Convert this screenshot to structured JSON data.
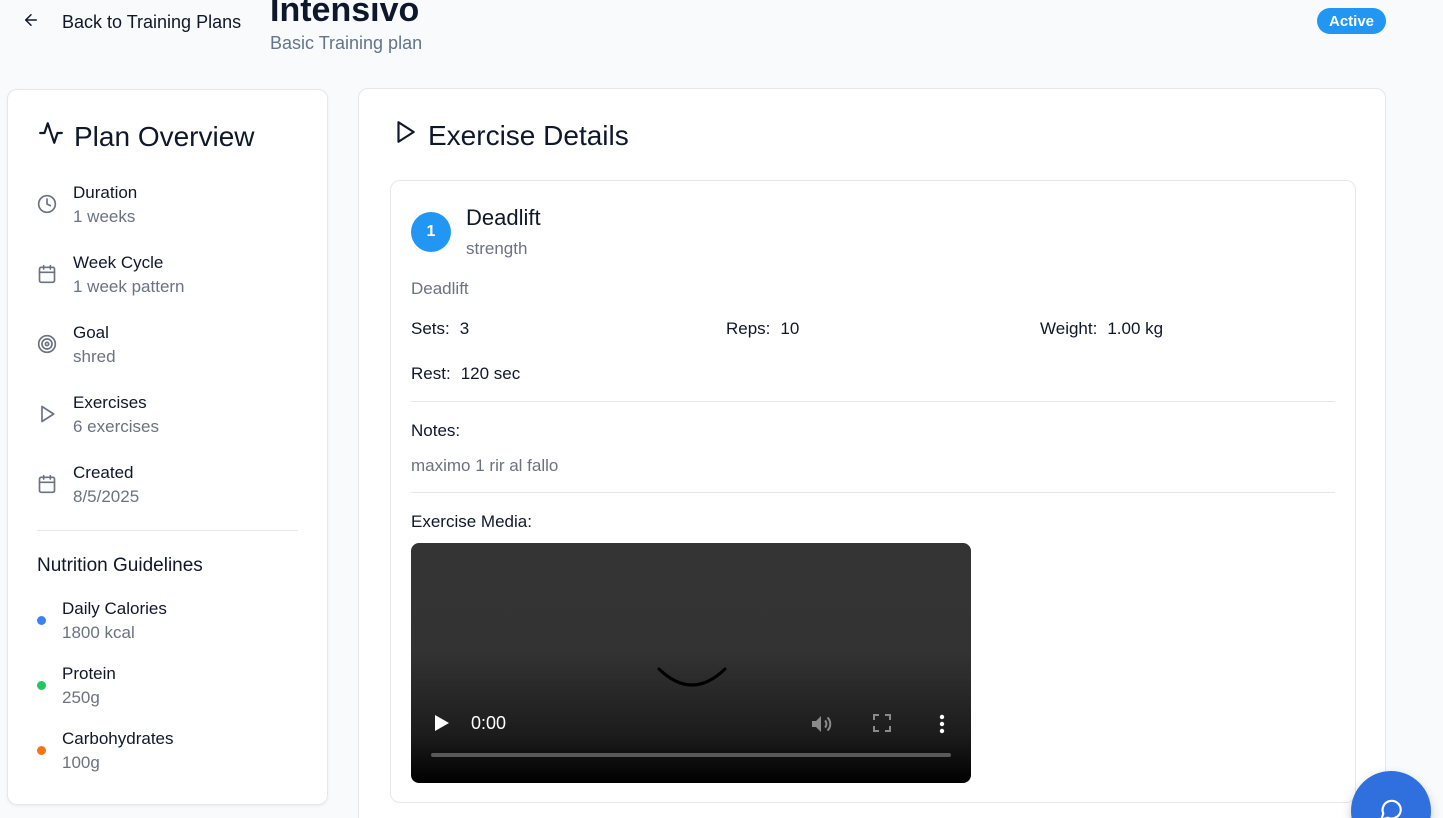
{
  "header": {
    "back_label": "Back to Training Plans",
    "title": "Intensivo",
    "subtitle": "Basic Training plan",
    "status": "Active"
  },
  "overview": {
    "title": "Plan Overview",
    "items": [
      {
        "label": "Duration",
        "value": "1 weeks",
        "icon": "clock-icon"
      },
      {
        "label": "Week Cycle",
        "value": "1 week pattern",
        "icon": "calendar-icon"
      },
      {
        "label": "Goal",
        "value": "shred",
        "icon": "target-icon"
      },
      {
        "label": "Exercises",
        "value": "6 exercises",
        "icon": "play-icon"
      },
      {
        "label": "Created",
        "value": "8/5/2025",
        "icon": "calendar-icon"
      }
    ]
  },
  "nutrition": {
    "title": "Nutrition Guidelines",
    "items": [
      {
        "label": "Daily Calories",
        "value": "1800 kcal",
        "color": "#3b82f6"
      },
      {
        "label": "Protein",
        "value": "250g",
        "color": "#22c55e"
      },
      {
        "label": "Carbohydrates",
        "value": "100g",
        "color": "#f97316"
      }
    ]
  },
  "exercise_details": {
    "title": "Exercise Details",
    "exercise": {
      "number": "1",
      "name": "Deadlift",
      "category": "strength",
      "description": "Deadlift",
      "sets_label": "Sets:",
      "sets": "3",
      "reps_label": "Reps:",
      "reps": "10",
      "weight_label": "Weight:",
      "weight": "1.00 kg",
      "rest_label": "Rest:",
      "rest": "120 sec",
      "notes_label": "Notes:",
      "notes": "maximo 1 rir al fallo",
      "media_label": "Exercise Media:",
      "video_time": "0:00"
    }
  },
  "colors": {
    "accent": "#2196f3",
    "fab": "#2f6fde"
  }
}
